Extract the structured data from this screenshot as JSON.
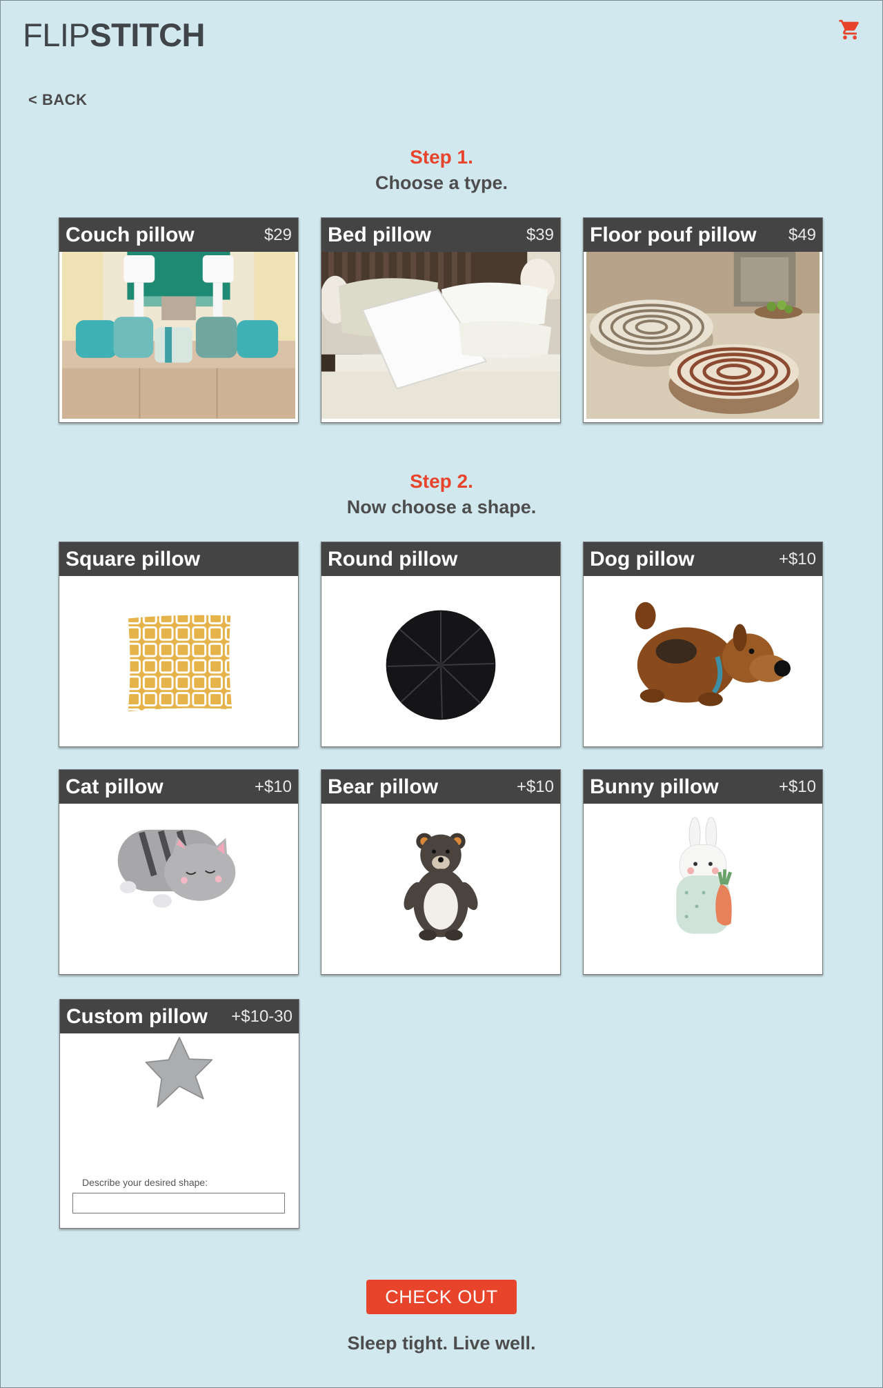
{
  "brand": {
    "thin": "FLIP",
    "bold": "STITCH"
  },
  "header": {
    "cart_icon": "shopping-cart-icon",
    "cart_color": "#e8442c"
  },
  "nav": {
    "back_label": "< BACK"
  },
  "step1": {
    "number": "Step 1.",
    "instruction": "Choose a type.",
    "options": [
      {
        "title": "Couch pillow",
        "price": "$29"
      },
      {
        "title": "Bed pillow",
        "price": "$39"
      },
      {
        "title": "Floor pouf pillow",
        "price": "$49"
      }
    ]
  },
  "step2": {
    "number": "Step 2.",
    "instruction": "Now choose a shape.",
    "options": [
      {
        "title": "Square pillow",
        "price": ""
      },
      {
        "title": "Round pillow",
        "price": ""
      },
      {
        "title": "Dog pillow",
        "price": "+$10"
      },
      {
        "title": "Cat pillow",
        "price": "+$10"
      },
      {
        "title": "Bear pillow",
        "price": "+$10"
      },
      {
        "title": "Bunny pillow",
        "price": "+$10"
      },
      {
        "title": "Custom pillow",
        "price": "+$10-30"
      }
    ],
    "custom_prompt": "Describe your desired shape:",
    "custom_value": ""
  },
  "checkout_label": "CHECK OUT",
  "tagline": "Sleep tight. Live well.",
  "colors": {
    "background": "#d1e8ee",
    "accent": "#e8442c",
    "card_header": "#444444"
  }
}
